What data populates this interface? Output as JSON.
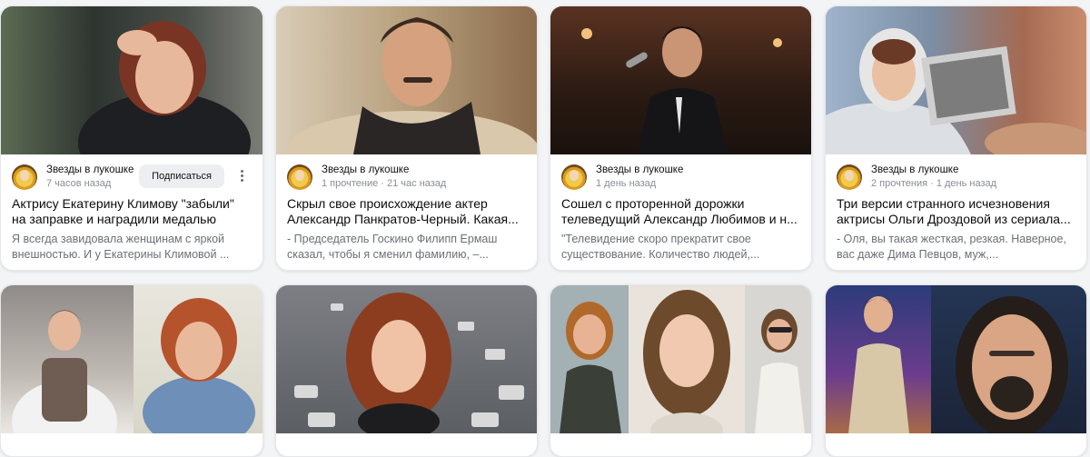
{
  "feed": {
    "cards": [
      {
        "channel": "Звезды в лукошке",
        "stats": "7 часов назад",
        "subscribe_label": "Подписаться",
        "title": "Актрису Екатерину Климову \"забыли\" на заправке и наградили медалью",
        "snippet": "Я всегда завидовала женщинам с яркой внешностью. И у Екатерины Климовой ..."
      },
      {
        "channel": "Звезды в лукошке",
        "stats": "1 прочтение · 21 час назад",
        "title": "Скрыл свое происхождение актер Александр Панкратов-Черный. Какая...",
        "snippet": "- Председатель Госкино Филипп Ермаш сказал, чтобы я сменил фамилию, –..."
      },
      {
        "channel": "Звезды в лукошке",
        "stats": "1 день назад",
        "title": "Сошел с проторенной дорожки телеведущий Александр Любимов и н...",
        "snippet": "\"Телевидение скоро прекратит свое существование. Количество людей,..."
      },
      {
        "channel": "Звезды в лукошке",
        "stats": "2 прочтения · 1 день назад",
        "title": "Три версии странного исчезновения актрисы Ольги Дроздовой из сериала...",
        "snippet": "- Оля, вы такая жесткая, резкая. Наверное, вас даже Дима Певцов, муж,..."
      }
    ]
  },
  "colors": {
    "page_bg": "#f3f4f6",
    "card_bg": "#ffffff",
    "subscribe_bg": "#eceef1",
    "muted_text": "#8a8d92"
  }
}
